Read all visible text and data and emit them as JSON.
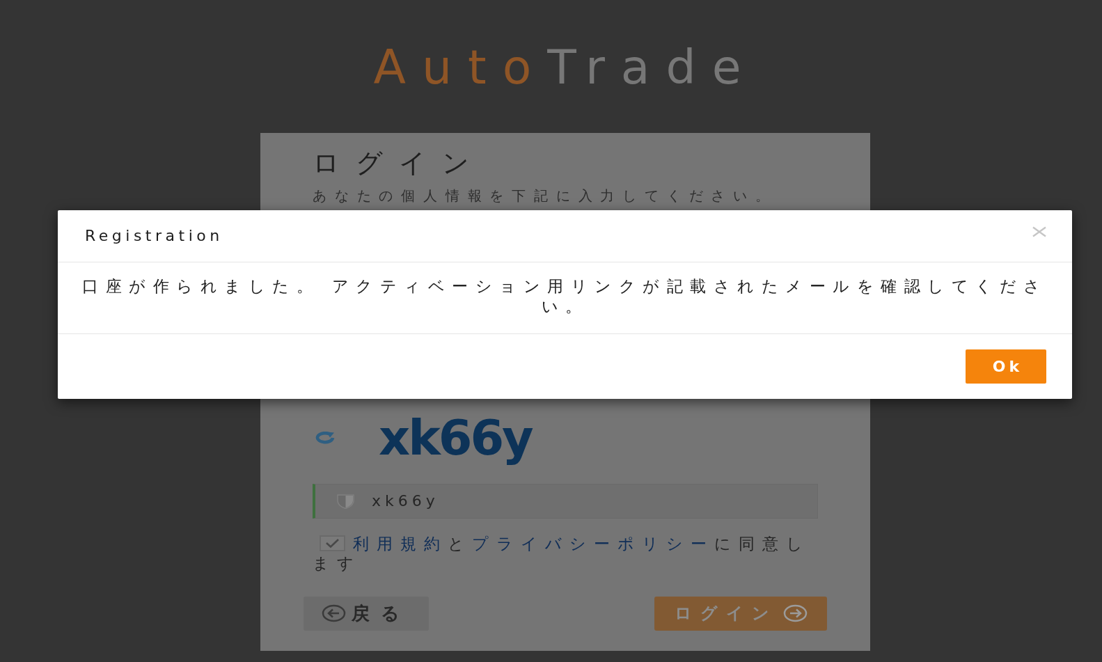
{
  "logo": {
    "accent": "Auto",
    "rest": "Trade"
  },
  "login_card": {
    "title": "ログイン",
    "subtitle": "あなたの個人情報を下記に入力してください。",
    "captcha": {
      "text": "xk66y"
    },
    "captcha_field": {
      "value": "xk66y",
      "valid": true
    },
    "terms": {
      "checked": true,
      "parts": [
        {
          "kind": "link",
          "text": "利用規約"
        },
        {
          "kind": "text",
          "text": "と"
        },
        {
          "kind": "link",
          "text": "プライバシーポリシー"
        },
        {
          "kind": "text",
          "text": "に同意します"
        }
      ]
    },
    "buttons": [
      {
        "kind": "back",
        "label": "戻る",
        "disabled": false
      },
      {
        "kind": "login",
        "label": "ログイン",
        "disabled": true
      }
    ]
  },
  "modal": {
    "title": "Registration",
    "message": "口座が作られました。 アクティベーション用リンクが記載されたメールを確認してください。",
    "buttons": [
      "Ok"
    ]
  }
}
